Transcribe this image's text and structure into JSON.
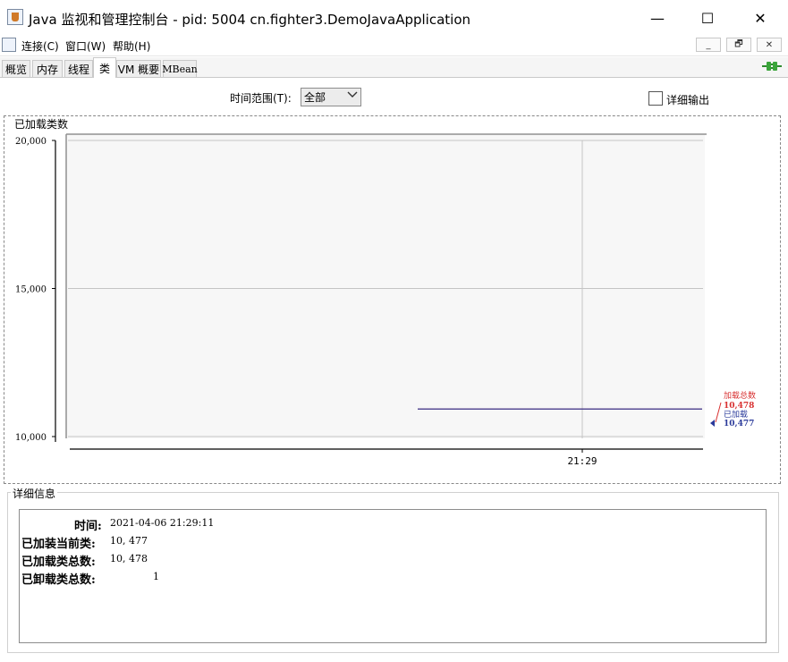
{
  "window": {
    "title": "Java 监视和管理控制台 - pid: 5004 cn.fighter3.DemoJavaApplication",
    "minimize": "—",
    "maximize": "☐",
    "close": "✕"
  },
  "menu": {
    "items": [
      "连接(C)",
      "窗口(W)",
      "帮助(H)"
    ],
    "mdi": [
      "_",
      "🗗",
      "✕"
    ]
  },
  "tabs": [
    "概览",
    "内存",
    "线程",
    "类",
    "VM 概要",
    "MBean"
  ],
  "active_tab": "类",
  "controls": {
    "time_range_label": "时间范围(T):",
    "time_range_value": "全部",
    "verbose_label": "详细输出",
    "verbose_checked": false
  },
  "chart": {
    "panel_title": "已加载类数"
  },
  "chart_data": {
    "type": "line",
    "y_ticks": [
      "20,000",
      "15,000",
      "10,000"
    ],
    "ylim": [
      10000,
      20000
    ],
    "x_ticks": [
      "21:29"
    ],
    "series": [
      {
        "name": "加载总数",
        "value": "10,478",
        "color": "#d83030"
      },
      {
        "name": "已加载",
        "value": "10,477",
        "color": "#2a3a9a"
      }
    ],
    "line_value": 10477,
    "grid": true
  },
  "details": {
    "panel_title": "详细信息",
    "rows": [
      {
        "label": "时间:",
        "value": "2021-04-06 21:29:11"
      },
      {
        "label": "已加装当前类:",
        "value": "10, 477"
      },
      {
        "label": "已加载类总数:",
        "value": "10, 478"
      },
      {
        "label": "已卸载类总数:",
        "value": "1"
      }
    ]
  }
}
